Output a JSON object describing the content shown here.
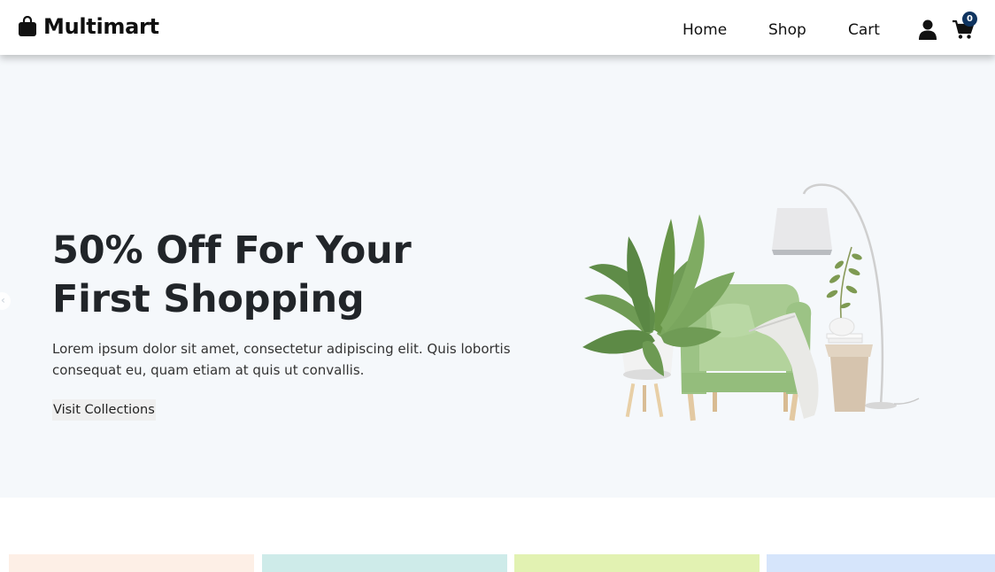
{
  "brand": {
    "name": "Multimart",
    "icon": "shopping-bag-icon"
  },
  "nav": {
    "links": [
      {
        "label": "Home"
      },
      {
        "label": "Shop"
      },
      {
        "label": "Cart"
      }
    ],
    "user_icon": "user-icon",
    "cart_icon": "cart-icon",
    "cart_count": "0",
    "badge_color": "#0f3460"
  },
  "hero": {
    "title": "50% Off For Your First Shopping",
    "description": "Lorem ipsum dolor sit amet, consectetur adipiscing elit. Quis lobortis consequat eu, quam etiam at quis ut convallis.",
    "button_label": "Visit Collections",
    "background": "#f5f8fb",
    "prev_icon": "chevron-left-icon"
  },
  "cards": {
    "colors": [
      "#fdefe6",
      "#ceebe9",
      "#e2f2b2",
      "#d6e5fb"
    ]
  }
}
